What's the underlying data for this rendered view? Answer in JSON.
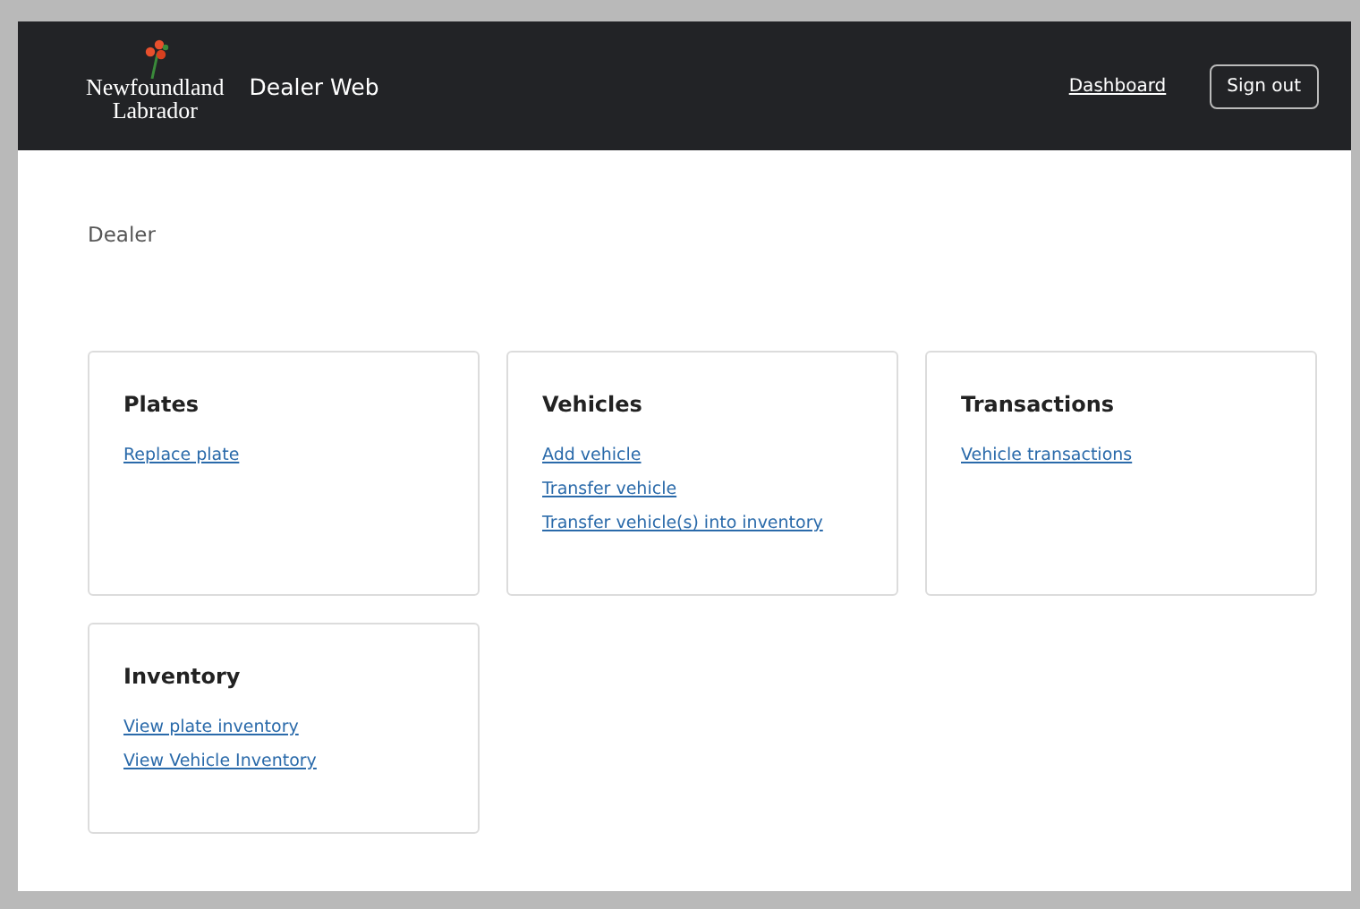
{
  "header": {
    "logo_lines": [
      "Newfoundland",
      "Labrador"
    ],
    "app_title": "Dealer Web",
    "nav_link": "Dashboard",
    "sign_out": "Sign out"
  },
  "breadcrumb": "Dealer",
  "cards": [
    {
      "title": "Plates",
      "links": [
        "Replace plate"
      ]
    },
    {
      "title": "Vehicles",
      "links": [
        "Add vehicle",
        "Transfer vehicle",
        "Transfer vehicle(s) into inventory"
      ]
    },
    {
      "title": "Transactions",
      "links": [
        "Vehicle transactions"
      ]
    },
    {
      "title": "Inventory",
      "links": [
        "View plate inventory",
        "View Vehicle Inventory"
      ]
    }
  ]
}
